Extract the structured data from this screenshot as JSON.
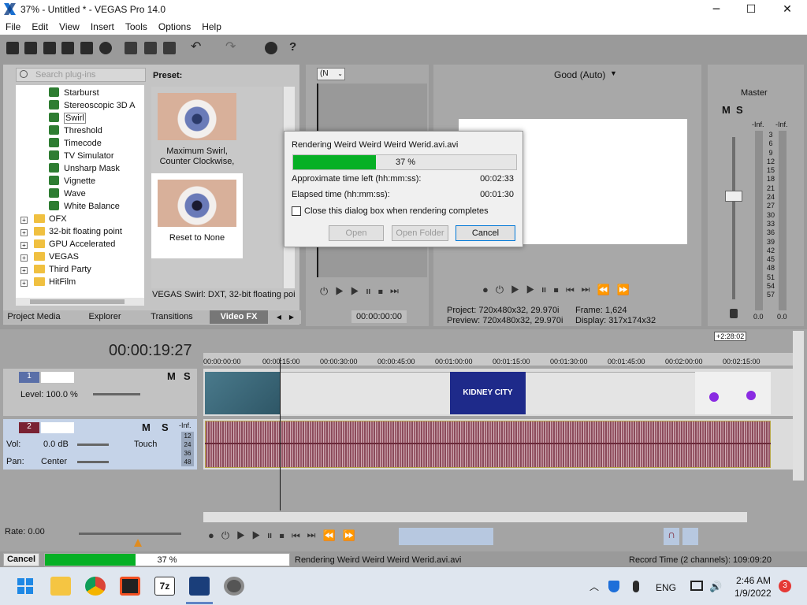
{
  "window": {
    "title": "37% - Untitled * - VEGAS Pro 14.0",
    "min": "─",
    "max": "☐",
    "close": "✕"
  },
  "menu": [
    "File",
    "Edit",
    "View",
    "Insert",
    "Tools",
    "Options",
    "Help"
  ],
  "plugins": {
    "search_placeholder": "Search plug-ins",
    "fx_items": [
      "Starburst",
      "Stereoscopic 3D A",
      "Swirl",
      "Threshold",
      "Timecode",
      "TV Simulator",
      "Unsharp Mask",
      "Vignette",
      "Wave",
      "White Balance"
    ],
    "folders": [
      "OFX",
      "32-bit floating point",
      "GPU Accelerated",
      "VEGAS",
      "Third Party",
      "HitFilm"
    ]
  },
  "preset": {
    "label": "Preset:",
    "items": [
      "Maximum Swirl, Counter Clockwise,",
      "Reset to None"
    ],
    "description": "VEGAS Swirl: DXT, 32-bit floating poin"
  },
  "tabs": [
    "Project Media",
    "Explorer",
    "Transitions",
    "Video FX"
  ],
  "trimmer": {
    "zoom": "(N",
    "timecode": "00:00:00:00"
  },
  "preview": {
    "quality": "Good (Auto)",
    "project_label": "Project:",
    "project_value": "720x480x32, 29.970i",
    "preview_label": "Preview:",
    "preview_value": "720x480x32, 29.970i",
    "frame_label": "Frame:",
    "frame_value": "1,624",
    "display_label": "Display:",
    "display_value": "317x174x32"
  },
  "master": {
    "label": "Master",
    "scale": [
      "-Inf.",
      "3",
      "6",
      "9",
      "12",
      "15",
      "18",
      "21",
      "24",
      "27",
      "30",
      "33",
      "36",
      "39",
      "42",
      "45",
      "48",
      "51",
      "54",
      "57"
    ],
    "left": "0.0",
    "right": "0.0",
    "inf_l": "-Inf.",
    "inf_r": "-Inf."
  },
  "render_dialog": {
    "title": "Rendering Weird Weird Weird Werid.avi.avi",
    "progress": 37,
    "progress_text": "37 %",
    "time_left_label": "Approximate time left (hh:mm:ss):",
    "time_left": "00:02:33",
    "elapsed_label": "Elapsed time (hh:mm:ss):",
    "elapsed": "00:01:30",
    "close_checkbox": "Close this dialog box when rendering completes",
    "open": "Open",
    "open_folder": "Open Folder",
    "cancel": "Cancel"
  },
  "timeline": {
    "current_time": "00:00:19:27",
    "end_marker": "+2:28:02",
    "ruler": [
      "00:00:00:00",
      "00:00:15:00",
      "00:00:30:00",
      "00:00:45:00",
      "00:01:00:00",
      "00:01:15:00",
      "00:01:30:00",
      "00:01:45:00",
      "00:02:00:00",
      "00:02:15:00"
    ],
    "video_track": {
      "number": "1",
      "level": "Level: 100.0 %",
      "m": "M",
      "s": "S"
    },
    "audio_track": {
      "number": "2",
      "vol_label": "Vol:",
      "vol": "0.0 dB",
      "pan_label": "Pan:",
      "pan": "Center",
      "touch": "Touch",
      "m": "M",
      "s": "S",
      "inf": "-Inf.",
      "meter": [
        "12",
        "24",
        "36",
        "48"
      ]
    },
    "clip_text": "KIDNEY CITY"
  },
  "rate": "Rate: 0.00",
  "status": {
    "cancel": "Cancel",
    "progress": 37,
    "progress_text": "37 %",
    "message": "Rendering Weird Weird Weird Werid.avi.avi",
    "record_time": "Record Time (2 channels): 109:09:20"
  },
  "taskbar": {
    "lang": "ENG",
    "time": "2:46 AM",
    "date": "1/9/2022",
    "badge": "3"
  },
  "colors": {
    "accent_green": "#06b025",
    "audio_wave": "#9a5a6a",
    "video_track_header": "#c5d3e8",
    "track_bg": "#dcdcdc"
  }
}
